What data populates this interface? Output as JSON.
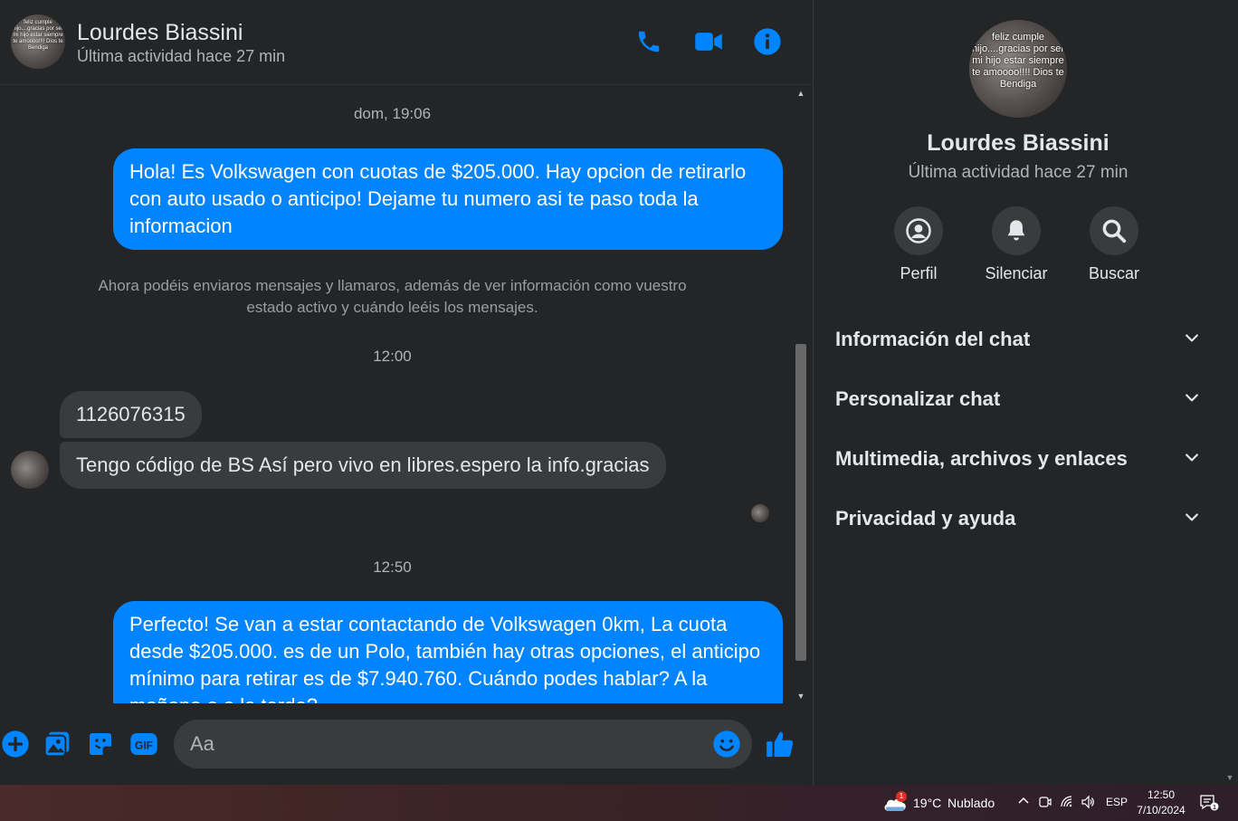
{
  "colors": {
    "accent": "#0084ff",
    "background": "#242526",
    "bubble_in": "#3a3b3c"
  },
  "header": {
    "name": "Lourdes Biassini",
    "status": "Última actividad hace 27 min",
    "avatar_caption": "feliz cumple hijo....gracias por ser mi hijo estar siempre te amoooo!!!! Dios te Bendiga",
    "icons": [
      "phone-icon",
      "video-camera-icon",
      "info-icon"
    ]
  },
  "messages": {
    "time_1": "dom, 19:06",
    "out_1": "Hola! Es Volkswagen con cuotas de $205.000. Hay opcion de retirarlo con auto usado o anticipo! Dejame tu numero asi te paso toda la informacion",
    "notice": "Ahora podéis enviaros mensajes y llamaros, además de ver información como vuestro estado activo y cuándo leéis los mensajes.",
    "time_2": "12:00",
    "in_1": "1126076315",
    "in_2": "Tengo código de BS Así pero vivo en libres.espero la info.gracias",
    "time_3": "12:50",
    "out_2": "Perfecto!  Se van a estar contactando de Volkswagen 0km, La cuota desde $205.000. es de un Polo, también hay otras opciones, el anticipo mínimo para retirar es de $7.940.760. Cuándo podes hablar? A la mañana o a la tarde?"
  },
  "composer": {
    "placeholder": "Aa",
    "icons": [
      "plus-icon",
      "image-icon",
      "sticker-icon",
      "gif-icon",
      "emoji-icon",
      "thumbs-up-icon"
    ],
    "gif_label": "GIF"
  },
  "side": {
    "name": "Lourdes Biassini",
    "status": "Última actividad hace 27 min",
    "avatar_caption": "feliz cumple hijo....gracias por ser mi hijo estar siempre te amoooo!!!! Dios te Bendiga",
    "actions": [
      {
        "label": "Perfil",
        "icon": "profile-icon"
      },
      {
        "label": "Silenciar",
        "icon": "bell-icon"
      },
      {
        "label": "Buscar",
        "icon": "search-icon"
      }
    ],
    "sections": [
      {
        "title": "Información del chat"
      },
      {
        "title": "Personalizar chat"
      },
      {
        "title": "Multimedia, archivos y enlaces"
      },
      {
        "title": "Privacidad y ayuda"
      }
    ]
  },
  "taskbar": {
    "weather_badge": "1",
    "weather_temp": "19°C",
    "weather_desc": "Nublado",
    "language": "ESP",
    "time": "12:50",
    "date": "7/10/2024",
    "notification_count": "1"
  }
}
